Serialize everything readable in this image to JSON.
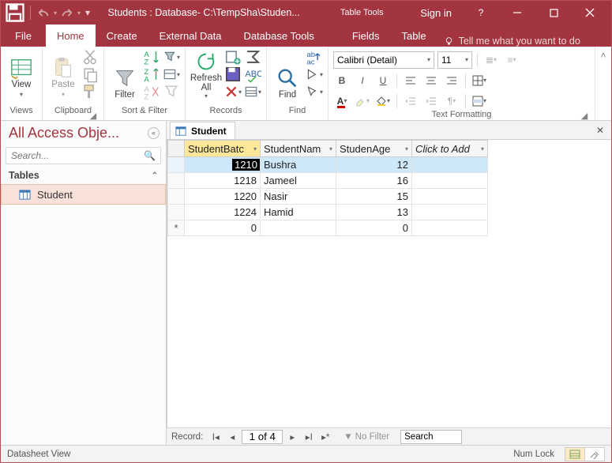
{
  "titlebar": {
    "title": "Students : Database- C:\\TempSha\\Studen...",
    "table_tools": "Table Tools",
    "sign_in": "Sign in"
  },
  "tabs": {
    "file": "File",
    "home": "Home",
    "create": "Create",
    "external": "External Data",
    "dbtools": "Database Tools",
    "fields": "Fields",
    "table": "Table",
    "tellme": "Tell me what you want to do"
  },
  "ribbon": {
    "views": {
      "label": "Views",
      "view": "View"
    },
    "clipboard": {
      "label": "Clipboard",
      "paste": "Paste"
    },
    "sortfilter": {
      "label": "Sort & Filter",
      "filter": "Filter"
    },
    "records": {
      "label": "Records",
      "refresh": "Refresh\nAll"
    },
    "find": {
      "label": "Find",
      "find": "Find"
    },
    "text": {
      "label": "Text Formatting",
      "font_name": "Calibri (Detail)",
      "font_size": "11"
    }
  },
  "nav": {
    "header": "All Access Obje...",
    "search_placeholder": "Search...",
    "section": "Tables",
    "items": [
      {
        "label": "Student"
      }
    ]
  },
  "doc": {
    "tab_label": "Student",
    "columns": [
      "StudentBatc",
      "StudentNam",
      "StudenAge",
      "Click to Add"
    ],
    "rows": [
      {
        "batch": "1210",
        "name": "Bushra",
        "age": "12",
        "selected": true,
        "editing": true
      },
      {
        "batch": "1218",
        "name": "Jameel",
        "age": "16"
      },
      {
        "batch": "1220",
        "name": "Nasir",
        "age": "15"
      },
      {
        "batch": "1224",
        "name": "Hamid",
        "age": "13"
      }
    ],
    "new_row": {
      "batch": "0",
      "age": "0"
    }
  },
  "recnav": {
    "label": "Record:",
    "position": "1 of 4",
    "nofilter": "No Filter",
    "search": "Search"
  },
  "status": {
    "view": "Datasheet View",
    "numlock": "Num Lock"
  }
}
